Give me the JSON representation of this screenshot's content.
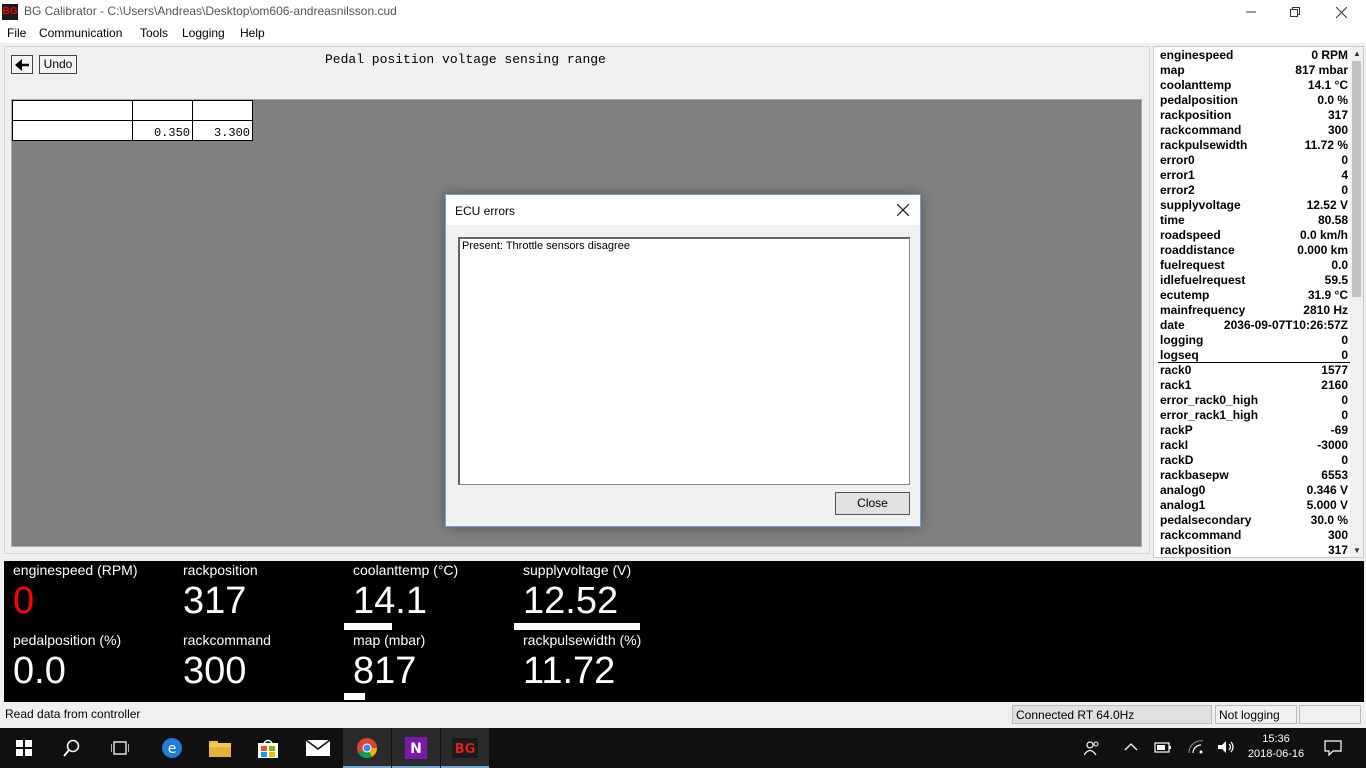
{
  "window": {
    "icon_text": "BG",
    "title": "BG Calibrator - C:\\Users\\Andreas\\Desktop\\om606-andreasnilsson.cud"
  },
  "menu": [
    "File",
    "Communication",
    "Tools",
    "Logging",
    "Help"
  ],
  "toolbar": {
    "undo_label": "Undo"
  },
  "map": {
    "title": "Pedal position voltage sensing range",
    "header": [
      "",
      "",
      ""
    ],
    "values": [
      "",
      "0.350",
      "3.300"
    ]
  },
  "sensors": [
    {
      "name": "enginespeed",
      "value": "0 RPM"
    },
    {
      "name": "map",
      "value": "817 mbar"
    },
    {
      "name": "coolanttemp",
      "value": "14.1 °C"
    },
    {
      "name": "pedalposition",
      "value": "0.0 %"
    },
    {
      "name": "rackposition",
      "value": "317"
    },
    {
      "name": "rackcommand",
      "value": "300"
    },
    {
      "name": "rackpulsewidth",
      "value": "11.72 %"
    },
    {
      "name": "error0",
      "value": "0"
    },
    {
      "name": "error1",
      "value": "4"
    },
    {
      "name": "error2",
      "value": "0"
    },
    {
      "name": "supplyvoltage",
      "value": "12.52 V"
    },
    {
      "name": "time",
      "value": "80.58"
    },
    {
      "name": "roadspeed",
      "value": "0.0 km/h"
    },
    {
      "name": "roaddistance",
      "value": "0.000 km"
    },
    {
      "name": "fuelrequest",
      "value": "0.0"
    },
    {
      "name": "idlefuelrequest",
      "value": "59.5"
    },
    {
      "name": "ecutemp",
      "value": "31.9 °C"
    },
    {
      "name": "mainfrequency",
      "value": "2810 Hz"
    },
    {
      "name": "date",
      "value": "2036-09-07T10:26:57Z"
    },
    {
      "name": "logging",
      "value": "0"
    },
    {
      "name": "logseq",
      "value": "0"
    },
    {
      "name": "rack0",
      "value": "1577"
    },
    {
      "name": "rack1",
      "value": "2160"
    },
    {
      "name": "error_rack0_high",
      "value": "0"
    },
    {
      "name": "error_rack1_high",
      "value": "0"
    },
    {
      "name": "rackP",
      "value": "-69"
    },
    {
      "name": "rackI",
      "value": "-3000"
    },
    {
      "name": "rackD",
      "value": "0"
    },
    {
      "name": "rackbasepw",
      "value": "6553"
    },
    {
      "name": "analog0",
      "value": "0.346 V"
    },
    {
      "name": "analog1",
      "value": "5.000 V"
    },
    {
      "name": "pedalsecondary",
      "value": "30.0 %"
    },
    {
      "name": "rackcommand",
      "value": "300"
    },
    {
      "name": "rackposition",
      "value": "317"
    }
  ],
  "gauges": [
    {
      "label": "enginespeed (RPM)",
      "value": "0",
      "color": "#ff0000",
      "bar_fraction": 0
    },
    {
      "label": "rackposition",
      "value": "317",
      "color": "#ffffff",
      "bar_fraction": 0
    },
    {
      "label": "coolanttemp (°C)",
      "value": "14.1",
      "color": "#ffffff",
      "bar_fraction": 0.3
    },
    {
      "label": "supplyvoltage (V)",
      "value": "12.52",
      "color": "#ffffff",
      "bar_fraction": 0.79
    },
    {
      "label": "pedalposition (%)",
      "value": "0.0",
      "color": "#ffffff",
      "bar_fraction": 0
    },
    {
      "label": "rackcommand",
      "value": "300",
      "color": "#ffffff",
      "bar_fraction": 0
    },
    {
      "label": "map (mbar)",
      "value": "817",
      "color": "#ffffff",
      "bar_fraction": 0.13
    },
    {
      "label": "rackpulsewidth (%)",
      "value": "11.72",
      "color": "#ffffff",
      "bar_fraction": 0
    }
  ],
  "status": {
    "message": "Read data from controller",
    "connection": "Connected RT 64.0Hz",
    "logging": "Not logging"
  },
  "dialog": {
    "title": "ECU errors",
    "message": "Present: Throttle sensors disagree",
    "close_label": "Close"
  },
  "taskbar": {
    "time": "15:36",
    "date": "2018-06-16",
    "app_badge": "BG",
    "icons": [
      "start-icon",
      "search-icon",
      "task-view-icon",
      "edge-icon",
      "file-explorer-icon",
      "store-icon",
      "mail-icon",
      "chrome-icon",
      "onenote-icon",
      "bg-calibrator-icon"
    ]
  }
}
